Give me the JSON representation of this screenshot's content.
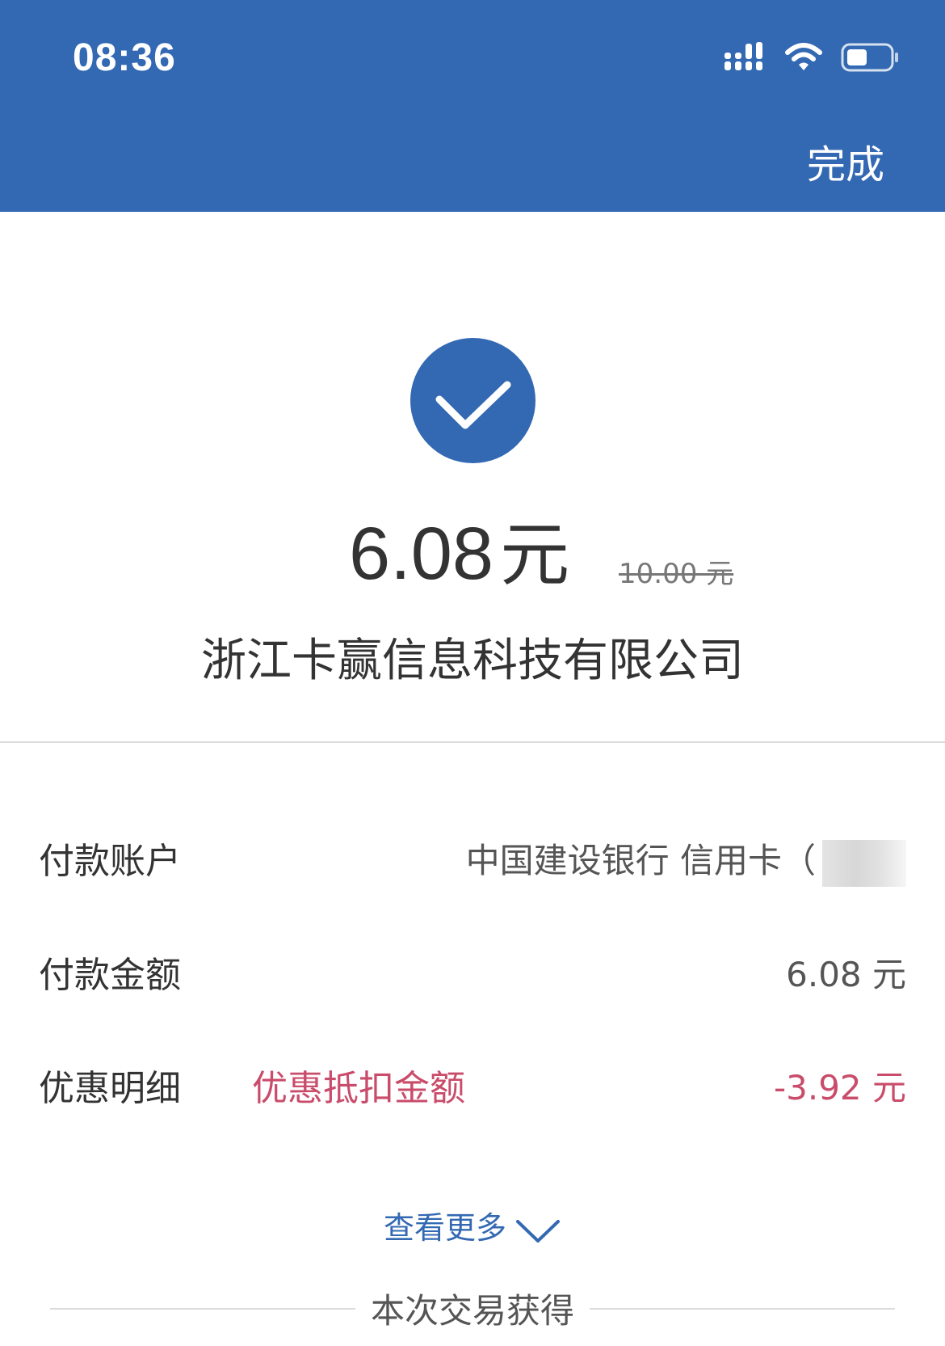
{
  "status_bar": {
    "time": "08:36",
    "icons": [
      "cellular-signal-icon",
      "wifi-icon",
      "battery-icon"
    ]
  },
  "header": {
    "done_label": "完成",
    "background_color": "#3369b2"
  },
  "result": {
    "icon": "checkmark-circle-icon",
    "amount": "6.08",
    "amount_unit": "元",
    "original_amount": "10.00 元",
    "merchant": "浙江卡赢信息科技有限公司"
  },
  "details": {
    "account": {
      "label": "付款账户",
      "value": "中国建设银行 信用卡（"
    },
    "amount": {
      "label": "付款金额",
      "value": "6.08 元"
    },
    "discount": {
      "label": "优惠明细",
      "sublabel": "优惠抵扣金额",
      "value": "-3.92 元",
      "color": "#c94c6b"
    }
  },
  "see_more": {
    "label": "查看更多",
    "icon": "chevron-down-icon"
  },
  "section": {
    "title": "本次交易获得"
  }
}
